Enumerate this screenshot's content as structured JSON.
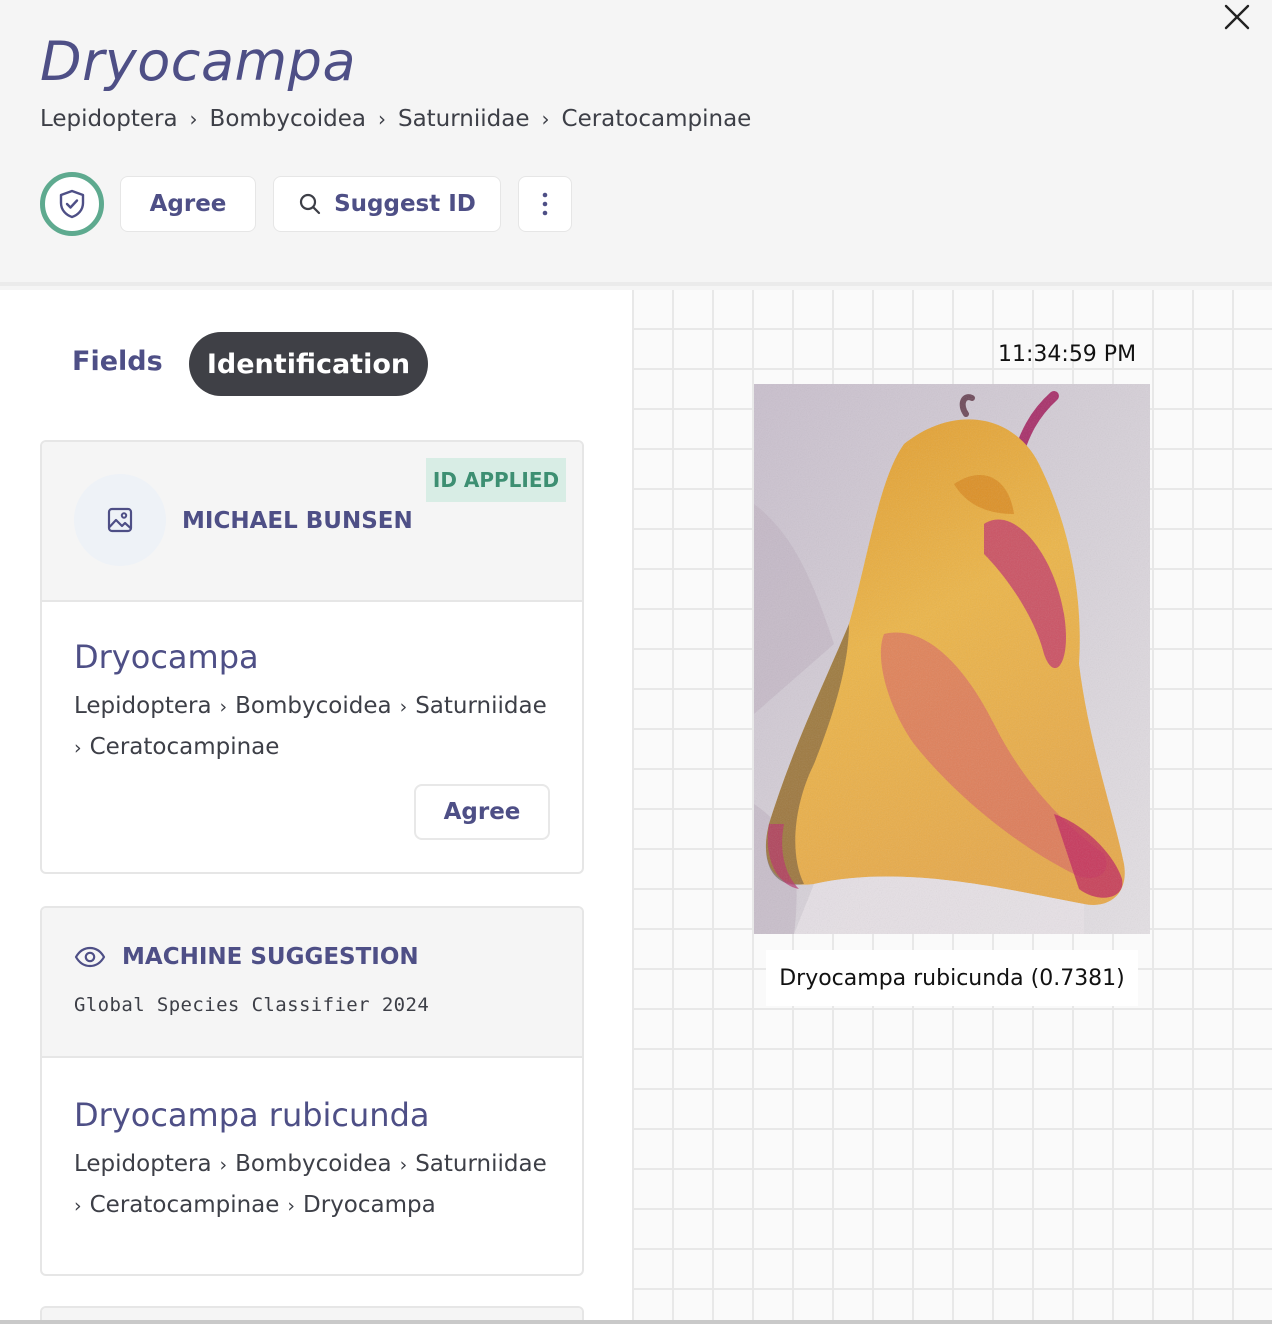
{
  "header": {
    "title": "Dryocampa",
    "breadcrumb": [
      "Lepidoptera",
      "Bombycoidea",
      "Saturniidae",
      "Ceratocampinae"
    ],
    "breadcrumb_sep": "›",
    "agree_label": "Agree",
    "suggest_label": "Suggest ID",
    "more_label": "⋮",
    "close_icon": "close-icon",
    "verified_icon": "shield-check-icon"
  },
  "tabs": {
    "fields": "Fields",
    "identification": "Identification",
    "active": "identification"
  },
  "identifications": [
    {
      "user": "MICHAEL BUNSEN",
      "badge": "ID APPLIED",
      "taxon": "Dryocampa",
      "lineage": [
        "Lepidoptera",
        "Bombycoidea",
        "Saturniidae",
        "Ceratocampinae"
      ],
      "agree_label": "Agree"
    }
  ],
  "machine_suggestion": {
    "label": "MACHINE SUGGESTION",
    "algorithm": "Global Species Classifier 2024",
    "taxon": "Dryocampa rubicunda",
    "lineage": [
      "Lepidoptera",
      "Bombycoidea",
      "Saturniidae",
      "Ceratocampinae",
      "Dryocampa"
    ]
  },
  "detection": {
    "timestamp": "11:34:59 PM",
    "caption": "Dryocampa rubicunda (0.7381)"
  },
  "colors": {
    "accent": "#4e4f86",
    "verified_ring": "#5eaa8f",
    "badge_bg": "#d8ede5",
    "badge_text": "#3d8f72",
    "active_tab_bg": "#3f4046"
  }
}
